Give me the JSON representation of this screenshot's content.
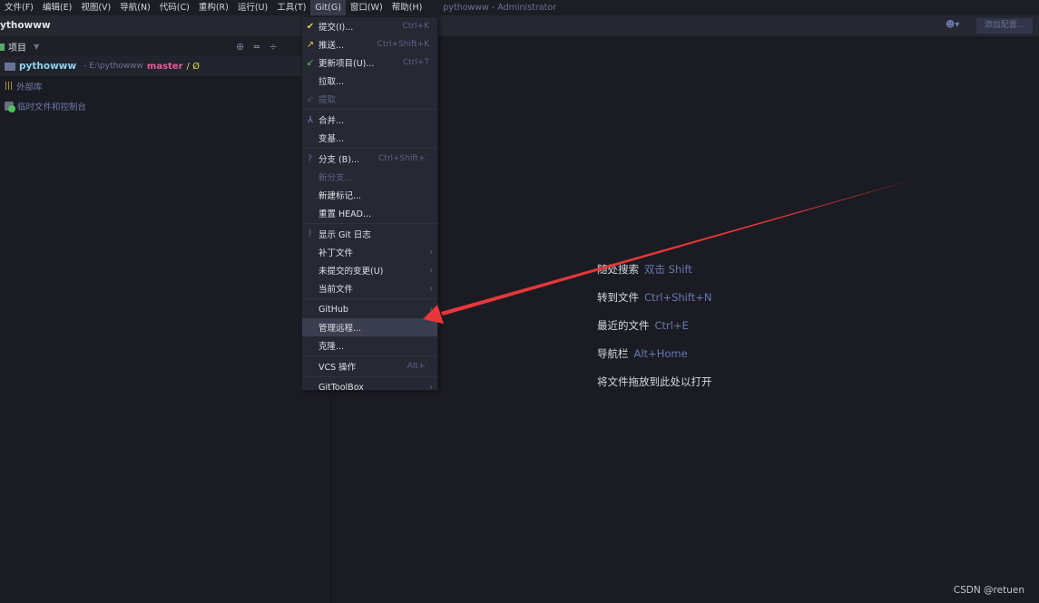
{
  "menubar": {
    "items": [
      "文件(F)",
      "编辑(E)",
      "视图(V)",
      "导航(N)",
      "代码(C)",
      "重构(R)",
      "运行(U)",
      "工具(T)",
      "Git(G)",
      "窗口(W)",
      "帮助(H)"
    ],
    "active": "Git(G)",
    "window_title": "pythowww - Administrator"
  },
  "toolbar": {
    "project_name": "ythowww",
    "add_config": "添加配置..."
  },
  "project_panel": {
    "title": "项目",
    "root": {
      "name": "pythowww",
      "path": "- E:\\pythowww",
      "branch": "master",
      "branch_suffix": "/ Ø"
    },
    "items": [
      "外部库",
      "临时文件和控制台"
    ]
  },
  "git_menu": {
    "groups": [
      [
        {
          "label": "提交(I)...",
          "shortcut": "Ctrl+K",
          "icon": "check-icon"
        },
        {
          "label": "推送...",
          "shortcut": "Ctrl+Shift+K",
          "icon": "push-arrow-icon"
        },
        {
          "label": "更新项目(U)...",
          "shortcut": "Ctrl+T",
          "icon": "update-arrow-icon"
        },
        {
          "label": "拉取..."
        },
        {
          "label": "提取",
          "disabled": true,
          "icon": "fetch-icon"
        }
      ],
      [
        {
          "label": "合并...",
          "icon": "merge-icon"
        },
        {
          "label": "变基..."
        }
      ],
      [
        {
          "label": "分支 (B)...",
          "shortcut": "Ctrl+Shift+`",
          "icon": "branch-icon"
        },
        {
          "label": "新分支...",
          "disabled": true
        },
        {
          "label": "新建标记..."
        },
        {
          "label": "重置 HEAD..."
        }
      ],
      [
        {
          "label": "显示 Git 日志",
          "icon": "branch-icon"
        },
        {
          "label": "补丁文件",
          "submenu": true
        },
        {
          "label": "未提交的变更(U)",
          "submenu": true
        },
        {
          "label": "当前文件",
          "submenu": true
        }
      ],
      [
        {
          "label": "GitHub",
          "submenu": true
        },
        {
          "label": "管理远程...",
          "highlighted": true
        },
        {
          "label": "克隆..."
        }
      ],
      [
        {
          "label": "VCS 操作",
          "shortcut": "Alt+`"
        }
      ],
      [
        {
          "label": "GitToolBox",
          "submenu": true
        }
      ]
    ]
  },
  "editor_hints": [
    {
      "label": "随处搜索",
      "key": "双击 Shift"
    },
    {
      "label": "转到文件",
      "key": "Ctrl+Shift+N"
    },
    {
      "label": "最近的文件",
      "key": "Ctrl+E"
    },
    {
      "label": "导航栏",
      "key": "Alt+Home"
    },
    {
      "label": "将文件拖放到此处以打开",
      "key": ""
    }
  ],
  "watermark": "CSDN @retuen",
  "colors": {
    "annotation_arrow": "#e8373a",
    "accent_branch": "#e85a9a",
    "shortcut": "#5d6385"
  }
}
